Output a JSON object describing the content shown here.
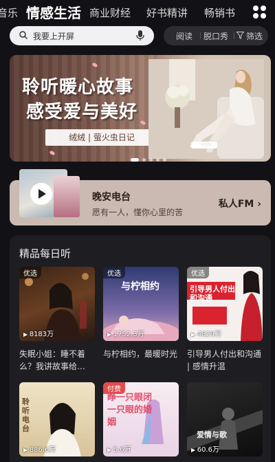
{
  "tabs": [
    {
      "label": "音乐"
    },
    {
      "label": "情感生活",
      "active": true
    },
    {
      "label": "商业财经"
    },
    {
      "label": "好书精讲"
    },
    {
      "label": "畅销书"
    }
  ],
  "search": {
    "placeholder": "我要上开屏"
  },
  "filters": {
    "read": "阅读",
    "talk": "脱口秀",
    "filter": "筛选"
  },
  "banner": {
    "line1": "聆听暖心故事",
    "line2": "感受爱与美好",
    "authors": "绒绒 | 萤火虫日记",
    "slide_count": 5,
    "active_slide": 0
  },
  "radio": {
    "title": "晚安电台",
    "desc": "愿有一人，懂你心里的苦",
    "link": "私人FM ›"
  },
  "daily": {
    "title": "精品每日听",
    "cards": [
      {
        "badge": "优选",
        "count": "8183万",
        "caption": "失眠小姐：睡不着么？我讲故事给…"
      },
      {
        "badge": "优选",
        "count": "1752.3万",
        "caption": "与柠相约，最暖时光",
        "cover_text": "与柠相约"
      },
      {
        "badge": "优选",
        "count": "4829万",
        "caption": "引导男人付出和沟通 | 感情升温",
        "cover_text": "引导男人付出和沟通"
      },
      {
        "badge": "",
        "count": "886.6万",
        "caption": "",
        "cover_text": "聆听电台"
      },
      {
        "badge": "付费",
        "count": "5.6万",
        "caption": "",
        "cover_text": "睁一只眼闭一只眼的婚姻"
      },
      {
        "badge": "",
        "count": "60.6万",
        "caption": "",
        "cover_text": "爱情与歌"
      }
    ]
  },
  "colors": {
    "bg": "#121216",
    "panel": "#1e1e22",
    "radio_card": "#cabab2",
    "paid_badge": "#e34c4c"
  }
}
